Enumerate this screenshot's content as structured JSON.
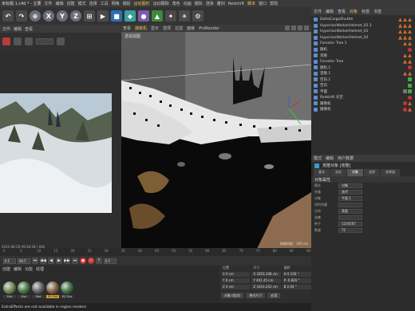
{
  "menubar": {
    "title": "未标题 1.c4d * - 主要",
    "items": [
      "文件",
      "编辑",
      "创建",
      "模式",
      "选择",
      "工具",
      "网格",
      "捕捉",
      "运动图形",
      "运动跟踪",
      "角色",
      "动画",
      "模拟",
      "渲染",
      "雕刻",
      "Redshift",
      "脚本",
      "窗口",
      "帮助"
    ],
    "highlight_index": 8
  },
  "toolbar": {
    "buttons": [
      "↶",
      "↷",
      "⊕",
      "X",
      "Y",
      "Z",
      "⊞",
      "▶",
      "■",
      "◆",
      "●",
      "▲",
      "✦",
      "☀",
      "⚙"
    ]
  },
  "left_panel": {
    "tabs": [
      "文件",
      "编辑",
      "查看"
    ],
    "render_caption": "2021-08-20  09:28:38  |  X84"
  },
  "viewport": {
    "menu": [
      "查看",
      "摄像机",
      "显示",
      "选项",
      "过滤",
      "面板",
      "ProRender"
    ],
    "menu_highlight": 1,
    "label": "透视视图",
    "grid_label": "网格间距：100 cm"
  },
  "objects": {
    "tabs": [
      "文件",
      "编辑",
      "查看",
      "对象",
      "标签",
      "书签"
    ],
    "tabs_highlight": 3,
    "rows": [
      {
        "name": "DeltaCargoShuttle",
        "tags": [
          "tri",
          "tri",
          "tri"
        ]
      },
      {
        "name": "HyperionWorkerHelmet_02.1",
        "tags": [
          "tri",
          "tri",
          "tri"
        ]
      },
      {
        "name": "HyperionWorkerHelmet_01",
        "tags": [
          "tri",
          "tri",
          "tri"
        ]
      },
      {
        "name": "HyperionWorkerHelmet_02",
        "tags": [
          "tri",
          "tri",
          "tri"
        ]
      },
      {
        "name": "Forester Tree 1",
        "tags": [
          "tri",
          "tri"
        ]
      },
      {
        "name": "随机",
        "tags": [
          "dot-red"
        ]
      },
      {
        "name": "克隆",
        "tags": [
          "tri",
          "tri"
        ]
      },
      {
        "name": "Forester Tree",
        "tags": [
          "tri",
          "tri"
        ]
      },
      {
        "name": "随机.1",
        "tags": [
          "dot-red"
        ]
      },
      {
        "name": "克隆.1",
        "tags": [
          "tri",
          "tri"
        ]
      },
      {
        "name": "空白.1",
        "tags": [
          "chk"
        ]
      },
      {
        "name": "空白",
        "tags": [
          "chk"
        ]
      },
      {
        "name": "平面",
        "tags": [
          "dot-gray",
          "chk"
        ]
      },
      {
        "name": "Redshift 天空",
        "tags": [
          "dot-red"
        ]
      },
      {
        "name": "摄像机",
        "tags": [
          "dot-red",
          "tri"
        ]
      },
      {
        "name": "摄像机",
        "tags": [
          "dot-red",
          "tri"
        ]
      }
    ]
  },
  "attributes": {
    "tabs": [
      "模式",
      "编辑",
      "用户数据"
    ],
    "head": "克隆对象 [克隆]",
    "subtabs": [
      "基本",
      "坐标",
      "对象",
      "变换",
      "效果器"
    ],
    "subtabs_on": 2,
    "section": "对象属性",
    "rows": [
      {
        "label": "模式",
        "value": "对象"
      },
      {
        "label": "克隆",
        "value": "迭代"
      },
      {
        "label": "对象",
        "value": "平面.1"
      },
      {
        "label": "排列克隆",
        "value": ""
      },
      {
        "label": "分布",
        "value": "表面"
      },
      {
        "label": "选集",
        "value": ""
      },
      {
        "label": "种子",
        "value": "1234567"
      },
      {
        "label": "数量",
        "value": "72"
      }
    ]
  },
  "timeline": {
    "ticks": [
      "0",
      "5",
      "10",
      "15",
      "20",
      "25",
      "30",
      "35",
      "40",
      "45",
      "50",
      "55",
      "60",
      "65",
      "70",
      "75",
      "80",
      "85",
      "90"
    ],
    "start": "0 F",
    "end": "90 F",
    "fps": "0 F",
    "buttons": [
      "⏮",
      "◀◀",
      "◀",
      "▶",
      "▶▶",
      "⏭",
      "●",
      "⊙",
      "?"
    ]
  },
  "materials": {
    "menu": [
      "创建",
      "编辑",
      "功能",
      "纹理"
    ],
    "items": [
      {
        "label": "Mat",
        "color": "#7a8e5c"
      },
      {
        "label": "Mat",
        "color": "#4d7d4d"
      },
      {
        "label": "Mat",
        "color": "#6a6a6a"
      },
      {
        "label": "RS Mat",
        "color": "#8a6b4a"
      },
      {
        "label": "RS Gro",
        "color": "#4a7a4a"
      }
    ],
    "selected_index": 3
  },
  "coords": {
    "headers": [
      "位置",
      "尺寸",
      "旋转"
    ],
    "rows": [
      [
        "X 0 cm",
        "X 3393.108 cm",
        "H 0.156 °"
      ],
      [
        "Y 0 cm",
        "Y 401.45 cm",
        "P -0.826 °"
      ],
      [
        "Z 0 cm",
        "Z 3410.243 cm",
        "B 2.64 °"
      ]
    ],
    "footer": [
      "对象 (相对)",
      "绝对尺寸",
      "应用"
    ]
  },
  "status": "ExtraEffects are not available in region renders"
}
